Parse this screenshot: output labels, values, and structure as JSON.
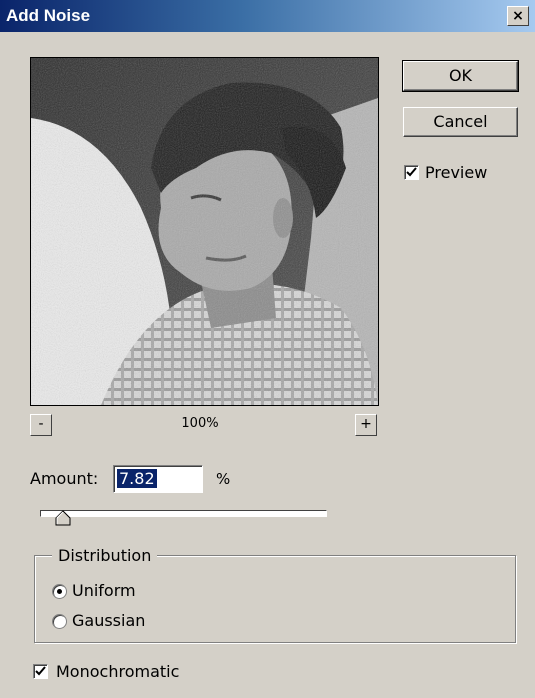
{
  "window": {
    "title": "Add Noise",
    "close_glyph": "×"
  },
  "buttons": {
    "ok_label": "OK",
    "cancel_label": "Cancel"
  },
  "preview_toggle": {
    "label": "Preview",
    "checked": true
  },
  "zoom": {
    "minus_label": "-",
    "plus_label": "+",
    "level": "100%"
  },
  "amount": {
    "label": "Amount:",
    "value": "7.82",
    "unit": "%",
    "slider_fraction": 0.08
  },
  "distribution": {
    "title": "Distribution",
    "options": [
      {
        "label": "Uniform",
        "selected": true
      },
      {
        "label": "Gaussian",
        "selected": false
      }
    ]
  },
  "monochromatic": {
    "label": "Monochromatic",
    "checked": true
  },
  "icons": {
    "check": "checkmark-icon",
    "slider": "slider-thumb-icon",
    "close": "close-icon"
  }
}
